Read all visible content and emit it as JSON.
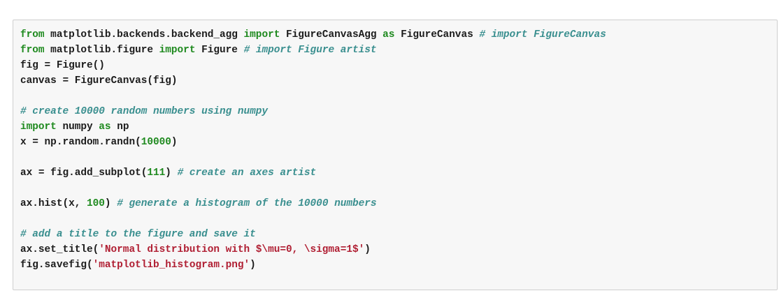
{
  "code_cell": {
    "lines": [
      [
        {
          "t": "from",
          "c": "kw"
        },
        {
          "t": " matplotlib.backends.backend_agg ",
          "c": "tx"
        },
        {
          "t": "import",
          "c": "kw"
        },
        {
          "t": " FigureCanvasAgg ",
          "c": "tx"
        },
        {
          "t": "as",
          "c": "kw"
        },
        {
          "t": " FigureCanvas ",
          "c": "tx"
        },
        {
          "t": "# import FigureCanvas",
          "c": "cm"
        }
      ],
      [
        {
          "t": "from",
          "c": "kw"
        },
        {
          "t": " matplotlib.figure ",
          "c": "tx"
        },
        {
          "t": "import",
          "c": "kw"
        },
        {
          "t": " Figure ",
          "c": "tx"
        },
        {
          "t": "# import Figure artist",
          "c": "cm"
        }
      ],
      [
        {
          "t": "fig = Figure()",
          "c": "tx"
        }
      ],
      [
        {
          "t": "canvas = FigureCanvas(fig)",
          "c": "tx"
        }
      ],
      [],
      [
        {
          "t": "# create 10000 random numbers using numpy",
          "c": "cm"
        }
      ],
      [
        {
          "t": "import",
          "c": "kw"
        },
        {
          "t": " numpy ",
          "c": "tx"
        },
        {
          "t": "as",
          "c": "kw"
        },
        {
          "t": " np",
          "c": "tx"
        }
      ],
      [
        {
          "t": "x = np.random.randn(",
          "c": "tx"
        },
        {
          "t": "10000",
          "c": "nm"
        },
        {
          "t": ")",
          "c": "tx"
        }
      ],
      [],
      [
        {
          "t": "ax = fig.add_subplot(",
          "c": "tx"
        },
        {
          "t": "111",
          "c": "nm"
        },
        {
          "t": ") ",
          "c": "tx"
        },
        {
          "t": "# create an axes artist",
          "c": "cm"
        }
      ],
      [],
      [
        {
          "t": "ax.hist(x, ",
          "c": "tx"
        },
        {
          "t": "100",
          "c": "nm"
        },
        {
          "t": ") ",
          "c": "tx"
        },
        {
          "t": "# generate a histogram of the 10000 numbers",
          "c": "cm"
        }
      ],
      [],
      [
        {
          "t": "# add a title to the figure and save it",
          "c": "cm"
        }
      ],
      [
        {
          "t": "ax.set_title(",
          "c": "tx"
        },
        {
          "t": "'Normal distribution with $\\mu=0, \\sigma=1$'",
          "c": "st"
        },
        {
          "t": ")",
          "c": "tx"
        }
      ],
      [
        {
          "t": "fig.savefig(",
          "c": "tx"
        },
        {
          "t": "'matplotlib_histogram.png'",
          "c": "st"
        },
        {
          "t": ")",
          "c": "tx"
        }
      ]
    ]
  }
}
